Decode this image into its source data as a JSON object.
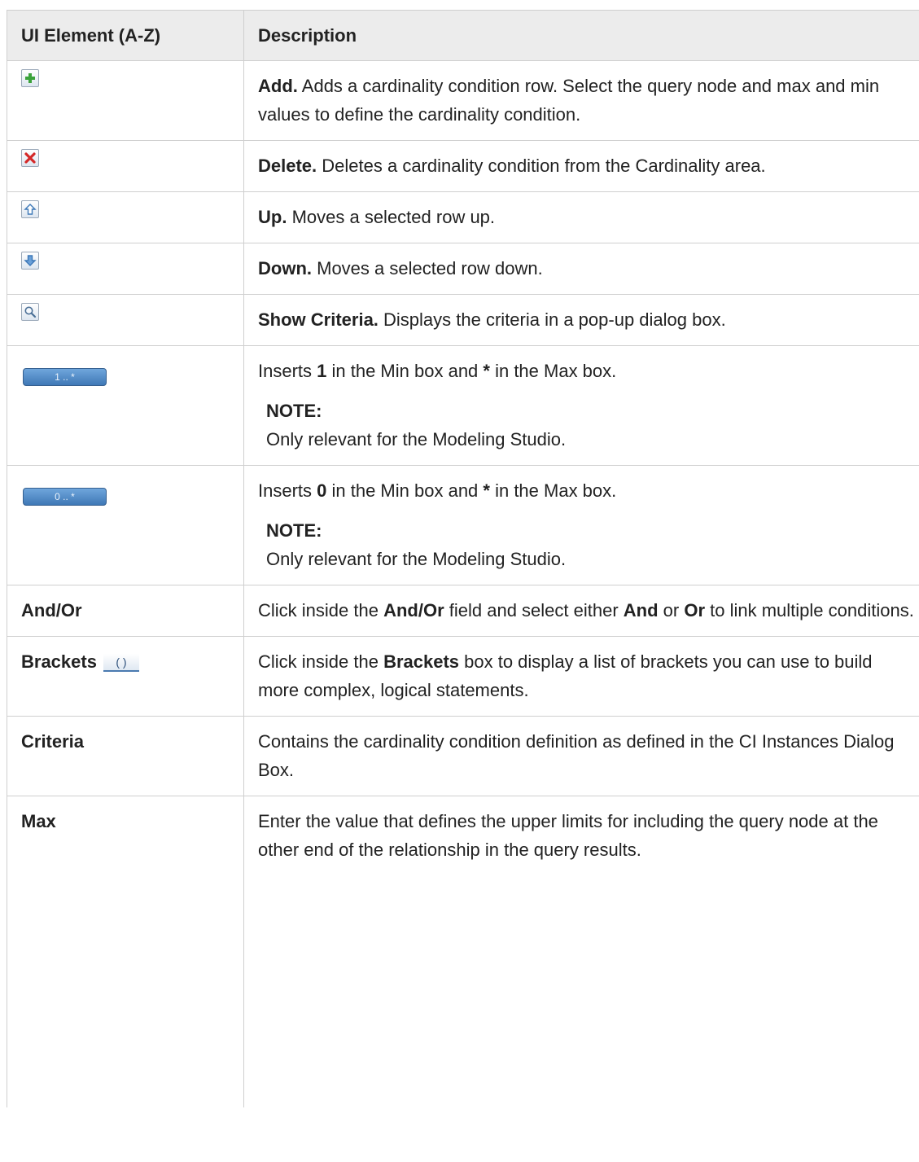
{
  "headers": {
    "element": "UI Element (A-Z)",
    "description": "Description"
  },
  "rows": {
    "add": {
      "icon": "add-plus-icon",
      "title": "Add.",
      "text": " Adds a cardinality condition row. Select the query node and max and min values to define the cardinality condition."
    },
    "delete": {
      "icon": "delete-x-icon",
      "title": "Delete.",
      "text": " Deletes a cardinality condition from the Cardinality area."
    },
    "up": {
      "icon": "arrow-up-icon",
      "title": "Up.",
      "text": " Moves a selected row up."
    },
    "down": {
      "icon": "arrow-down-icon",
      "title": "Down.",
      "text": " Moves a selected row down."
    },
    "show_criteria": {
      "icon": "magnifier-icon",
      "title": "Show Criteria.",
      "text": " Displays the criteria in a pop-up dialog box."
    },
    "one_many": {
      "button_label": "1 .. *",
      "t1": "Inserts ",
      "b1": "1",
      "t2": " in the Min box and ",
      "b2": "*",
      "t3": " in the Max box.",
      "note_title": "NOTE:",
      "note_text": "Only relevant for the Modeling Studio."
    },
    "zero_many": {
      "button_label": "0 .. *",
      "t1": "Inserts ",
      "b1": "0",
      "t2": " in the Min box and ",
      "b2": "*",
      "t3": " in the Max box.",
      "note_title": "NOTE:",
      "note_text": "Only relevant for the Modeling Studio."
    },
    "and_or": {
      "label": "And/Or",
      "t1": "Click inside the ",
      "b1": "And/Or",
      "t2": " field and select either ",
      "b2": "And",
      "t3": " or ",
      "b3": "Or",
      "t4": " to link multiple conditions."
    },
    "brackets": {
      "label": "Brackets",
      "button_label": "( )",
      "t1": "Click inside the ",
      "b1": "Brackets",
      "t2": " box to display a list of brackets you can use to build more complex, logical statements."
    },
    "criteria": {
      "label": "Criteria",
      "text": "Contains the cardinality condition definition as defined in the CI Instances Dialog Box."
    },
    "max": {
      "label": "Max",
      "text": "Enter the value that defines the upper limits for including the query node at the other end of the relationship in the query results."
    }
  },
  "colors": {
    "header_bg": "#ececec",
    "border": "#cfcfcf",
    "button_blue": "#4a84c4"
  }
}
